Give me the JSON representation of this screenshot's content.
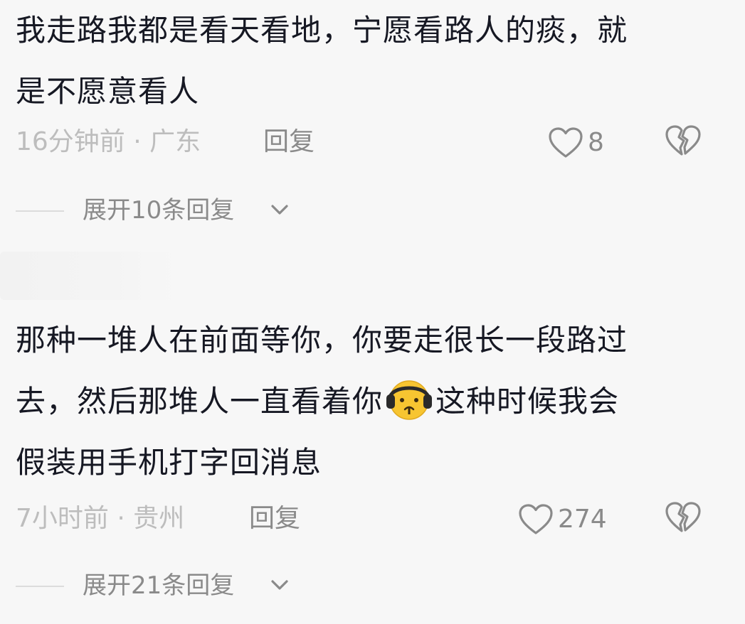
{
  "comments": [
    {
      "text_lines": [
        "我走路我都是看天看地，宁愿看路人的痰，就",
        "是不愿意看人"
      ],
      "time": "16分钟前 · 广东",
      "reply_label": "回复",
      "likes": "8",
      "expand_label": "展开10条回复"
    },
    {
      "text_lines": [
        "那种一堆人在前面等你，你要走很长一段路过",
        "去，然后那堆人一直看着你",
        "这种时候我会",
        "假装用手机打字回消息"
      ],
      "emoji": "headphones-sad-face",
      "time": "7小时前 · 贵州",
      "reply_label": "回复",
      "likes": "274",
      "expand_label": "展开21条回复"
    }
  ],
  "colors": {
    "background": "#f7f7f7",
    "text_primary": "#161823",
    "text_meta": "#bdbdbd",
    "text_secondary": "#8a8a8a",
    "icon": "#8a8a8a"
  },
  "icons": [
    "heart-outline-icon",
    "broken-heart-icon",
    "chevron-down-icon"
  ]
}
